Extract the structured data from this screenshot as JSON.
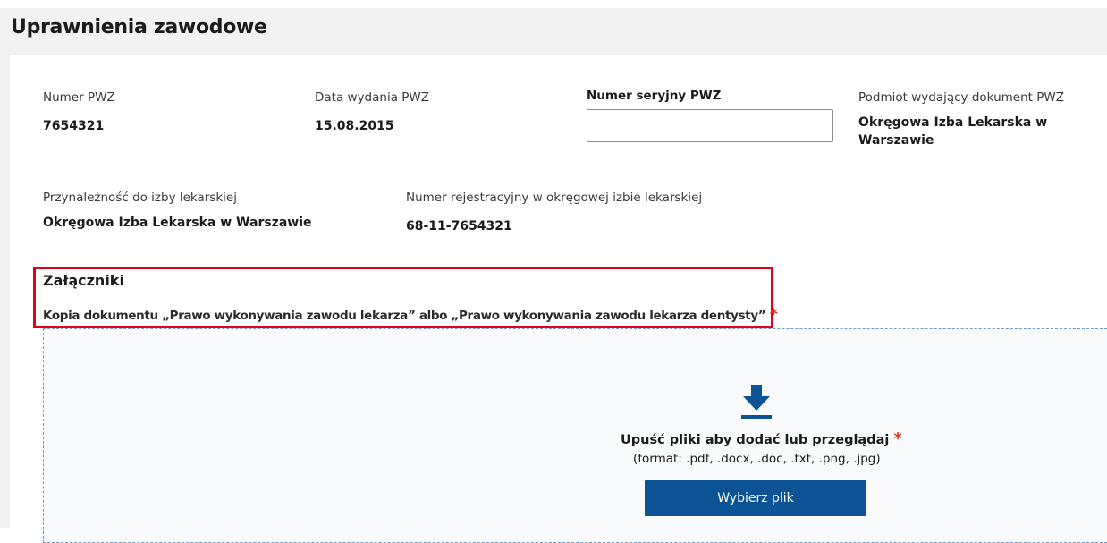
{
  "page": {
    "title": "Uprawnienia zawodowe"
  },
  "fields": {
    "pwz_number": {
      "label": "Numer PWZ",
      "value": "7654321"
    },
    "issue_date": {
      "label": "Data wydania PWZ",
      "value": "15.08.2015"
    },
    "serial_number": {
      "label": "Numer seryjny PWZ",
      "value": "",
      "placeholder": ""
    },
    "issuer": {
      "label": "Podmiot wydający dokument PWZ",
      "value": "Okręgowa Izba Lekarska w Warszawie"
    },
    "chamber": {
      "label": "Przynależność do izby lekarskiej",
      "value": "Okręgowa Izba Lekarska w Warszawie"
    },
    "registration": {
      "label": "Numer rejestracyjny w okręgowej izbie lekarskiej",
      "value": "68-11-7654321"
    }
  },
  "attachments": {
    "heading": "Załączniki",
    "description": "Kopia dokumentu „Prawo wykonywania zawodu lekarza” albo „Prawo wykonywania zawodu lekarza dentysty”",
    "required_mark": "*",
    "dropzone": {
      "icon": "download-icon",
      "title": "Upuść pliki aby dodać lub przeglądaj",
      "required_mark": "*",
      "formats": "(format: .pdf, .docx, .doc, .txt, .png, .jpg)",
      "button_label": "Wybierz plik"
    }
  },
  "colors": {
    "primary_button": "#0b5394",
    "required": "#d4351c",
    "highlight_border": "#e3001b"
  }
}
